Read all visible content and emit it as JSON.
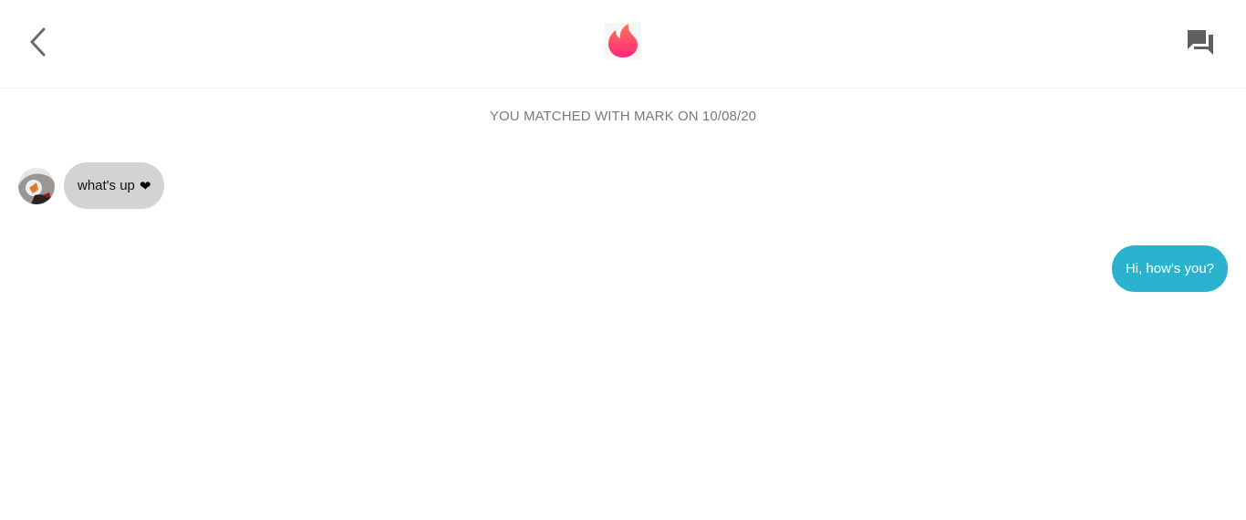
{
  "header": {
    "back_icon": "chevron-left-icon",
    "logo_icon": "flame-icon",
    "chats_icon": "forum-icon"
  },
  "conversation": {
    "match_notice": "YOU MATCHED WITH MARK ON 10/08/20",
    "messages": [
      {
        "direction": "incoming",
        "text": "what's up",
        "emoji": "❤︎"
      },
      {
        "direction": "outgoing",
        "text": "Hi, how's you?"
      }
    ]
  },
  "colors": {
    "accent_gradient_top": "#ff7854",
    "accent_gradient_bottom": "#fd267d",
    "incoming_bubble": "#d3d3d3",
    "outgoing_bubble": "#2ab3cf",
    "notice_text": "#7a7a7a",
    "icon_gray": "#6b6b6b"
  }
}
